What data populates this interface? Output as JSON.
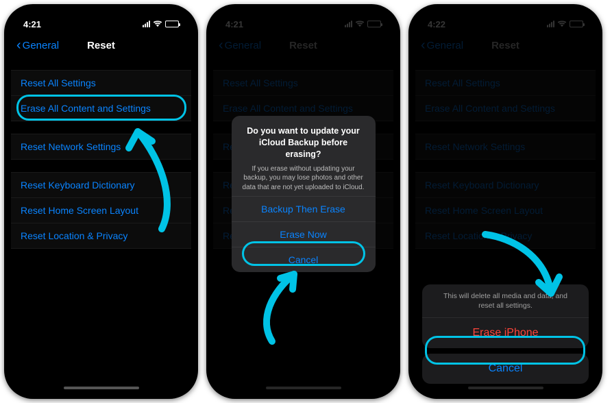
{
  "status": {
    "time1": "4:21",
    "time2": "4:21",
    "time3": "4:22"
  },
  "nav": {
    "back": "General",
    "title": "Reset"
  },
  "rows": {
    "resetAll": "Reset All Settings",
    "eraseAll": "Erase All Content and Settings",
    "resetNetwork": "Reset Network Settings",
    "resetKeyboard": "Reset Keyboard Dictionary",
    "resetHome": "Reset Home Screen Layout",
    "resetLocation": "Reset Location & Privacy"
  },
  "dialog": {
    "title": "Do you want to update your iCloud Backup before erasing?",
    "message": "If you erase without updating your backup, you may lose photos and other data that are not yet uploaded to iCloud.",
    "backup": "Backup Then Erase",
    "eraseNow": "Erase Now",
    "cancel": "Cancel"
  },
  "sheet": {
    "message": "This will delete all media and data, and reset all settings.",
    "erase": "Erase iPhone",
    "cancel": "Cancel"
  },
  "colors": {
    "accent": "#0a84ff",
    "highlight": "#00c3e6",
    "danger": "#ff453a"
  }
}
